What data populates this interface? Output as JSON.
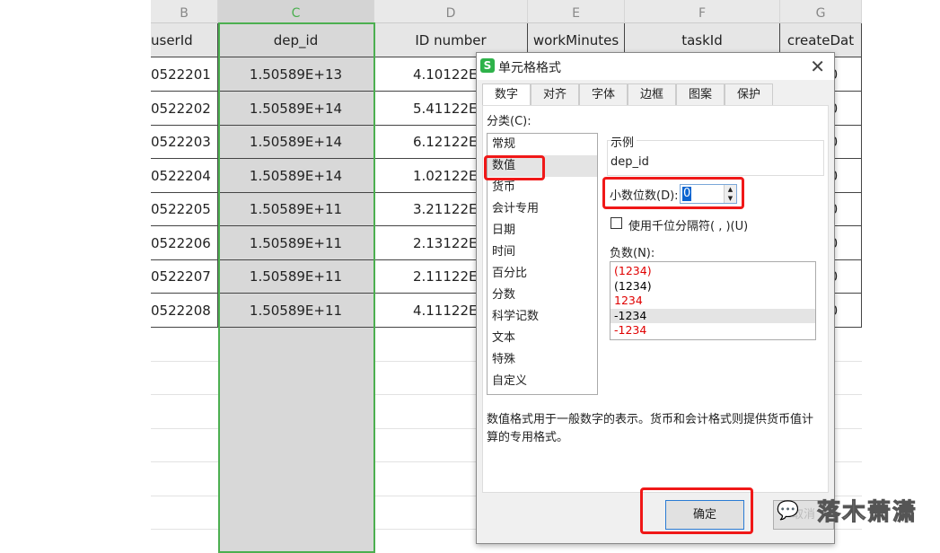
{
  "sheet": {
    "columns": [
      {
        "letter": "B",
        "header": "userId",
        "cells": [
          "0522201",
          "0522202",
          "0522203",
          "0522204",
          "0522205",
          "0522206",
          "0522207",
          "0522208"
        ]
      },
      {
        "letter": "C",
        "header": "dep_id",
        "cells": [
          "1.50589E+13",
          "1.50589E+14",
          "1.50589E+14",
          "1.50589E+14",
          "1.50589E+11",
          "1.50589E+11",
          "1.50589E+11",
          "1.50589E+11"
        ]
      },
      {
        "letter": "D",
        "header": "ID number",
        "cells": [
          "4.10122E+",
          "5.41122E+",
          "6.12122E+",
          "1.02122E+",
          "3.21122E+",
          "2.13122E+",
          "2.11122E+",
          "4.11122E+"
        ]
      },
      {
        "letter": "E",
        "header": "workMinutes",
        "cells": [
          "",
          "",
          "",
          "",
          "",
          "",
          "",
          ""
        ]
      },
      {
        "letter": "F",
        "header": "taskId",
        "cells": [
          "",
          "",
          "",
          "",
          "",
          "",
          "",
          ""
        ]
      },
      {
        "letter": "G",
        "header": "createDat",
        "cells": [
          "/1 10",
          "/2 10",
          "/3 10",
          "/4 10",
          "/5 10",
          "/6 10",
          "/7 10",
          "/8 10"
        ]
      }
    ],
    "selection_color": "#4caf50"
  },
  "dialog": {
    "title": "单元格格式",
    "close_icon": "close-icon",
    "tabs": [
      "数字",
      "对齐",
      "字体",
      "边框",
      "图案",
      "保护"
    ],
    "active_tab": "数字",
    "category_label": "分类(C):",
    "categories": [
      "常规",
      "数值",
      "货币",
      "会计专用",
      "日期",
      "时间",
      "百分比",
      "分数",
      "科学记数",
      "文本",
      "特殊",
      "自定义"
    ],
    "selected_category": "数值",
    "sample_label": "示例",
    "sample_value": "dep_id",
    "decimal_label": "小数位数(D):",
    "decimal_value": "0",
    "thousands_label": "使用千位分隔符( , )(U)",
    "thousands_checked": false,
    "negative_label": "负数(N):",
    "negative_options": [
      {
        "text": "(1234)",
        "color": "#e00000"
      },
      {
        "text": "(1234)",
        "color": "#000000"
      },
      {
        "text": "1234",
        "color": "#e00000"
      },
      {
        "text": "-1234",
        "color": "#000000"
      },
      {
        "text": "-1234",
        "color": "#e00000"
      }
    ],
    "selected_negative": "-1234",
    "description": "数值格式用于一般数字的表示。货币和会计格式则提供货币值计算的专用格式。",
    "ok_label": "确定",
    "cancel_label": "取消",
    "highlight_color": "#f01818"
  },
  "watermark": "落木萧潇"
}
